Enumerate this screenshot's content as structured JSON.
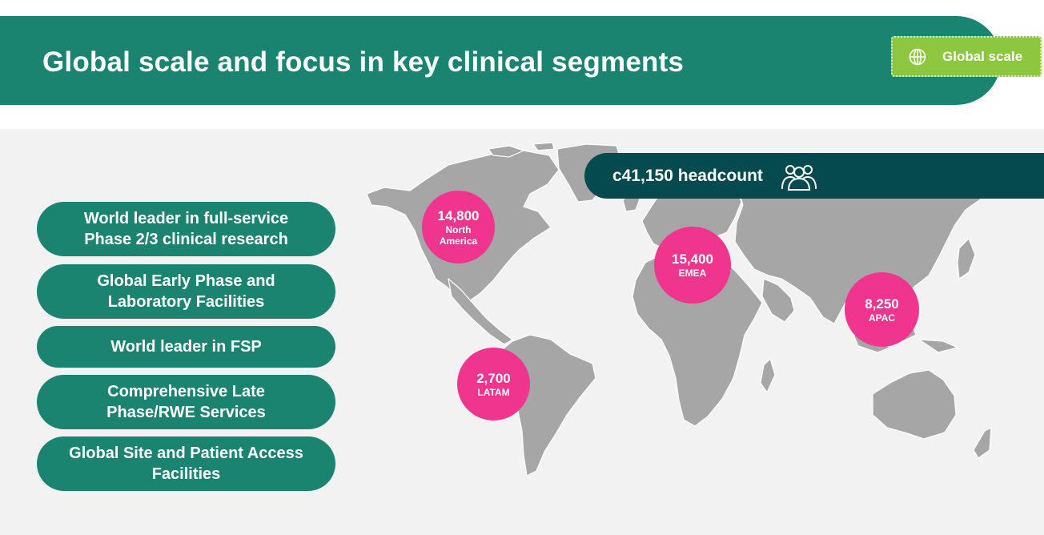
{
  "header": {
    "title": "Global scale and focus in key clinical segments",
    "badge_label": "Global scale",
    "badge_icon": "globe-icon"
  },
  "segments": [
    {
      "line1": "World leader in full-service",
      "line2": "Phase 2/3 clinical research"
    },
    {
      "line1": "Global Early Phase and",
      "line2": "Laboratory Facilities"
    },
    {
      "line1": "World leader in FSP",
      "line2": ""
    },
    {
      "line1": "Comprehensive Late",
      "line2": "Phase/RWE Services"
    },
    {
      "line1": "Global Site and Patient Access",
      "line2": "Facilities"
    }
  ],
  "headcount": {
    "label": "c41,150 headcount",
    "icon": "people-group-icon"
  },
  "regions": [
    {
      "value": "14,800",
      "label": "North America"
    },
    {
      "value": "15,400",
      "label": "EMEA"
    },
    {
      "value": "8,250",
      "label": "APAC"
    },
    {
      "value": "2,700",
      "label": "LATAM"
    }
  ],
  "colors": {
    "primary_green": "#1b8471",
    "dark_teal": "#044a4e",
    "lime": "#8dc63f",
    "magenta": "#f0358f",
    "map_gray": "#a6a6a6",
    "background": "#f2f2f2"
  }
}
